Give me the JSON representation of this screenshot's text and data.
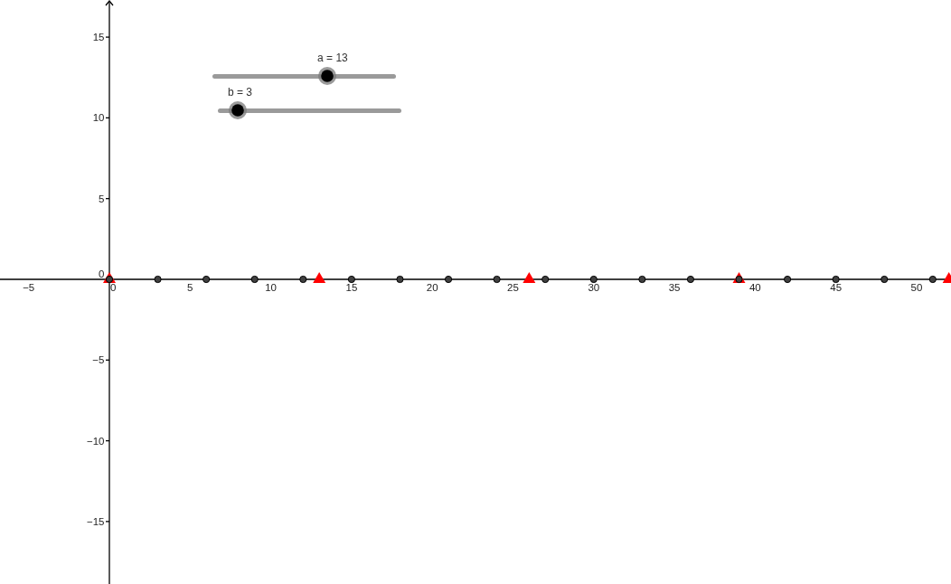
{
  "sliders": [
    {
      "label": "a = 13",
      "level": 0.626
    },
    {
      "label": "b = 3",
      "level": 0.108
    }
  ],
  "graph": {
    "chart_data": {
      "type": "scatter",
      "xlim": [
        -6.775,
        52.13
      ],
      "ylim": [
        -18.87,
        17.3
      ],
      "xticks": [
        {
          "value": -5,
          "label": "−5"
        },
        0,
        5,
        10,
        15,
        20,
        25,
        30,
        35,
        40,
        45,
        50
      ],
      "yticks": [
        15,
        10,
        5,
        0,
        {
          "value": -5,
          "label": "−5"
        },
        {
          "value": -10,
          "label": "−10"
        },
        {
          "value": -15,
          "label": "−15"
        }
      ],
      "series": [
        {
          "color": "#ff0000",
          "marker": "triangle",
          "x": [
            0,
            13,
            26,
            39,
            52
          ],
          "values": [
            0,
            0,
            0,
            0,
            0
          ]
        },
        {
          "color": "#404040",
          "marker": "circle",
          "x": [
            0,
            3,
            6,
            9,
            12,
            15,
            18,
            21,
            24,
            27,
            30,
            33,
            36,
            39,
            42,
            45,
            48,
            51
          ],
          "values": [
            0,
            0,
            0,
            0,
            0,
            0,
            0,
            0,
            0,
            0,
            0,
            0,
            0,
            0,
            0,
            0,
            0,
            0
          ]
        }
      ]
    }
  }
}
